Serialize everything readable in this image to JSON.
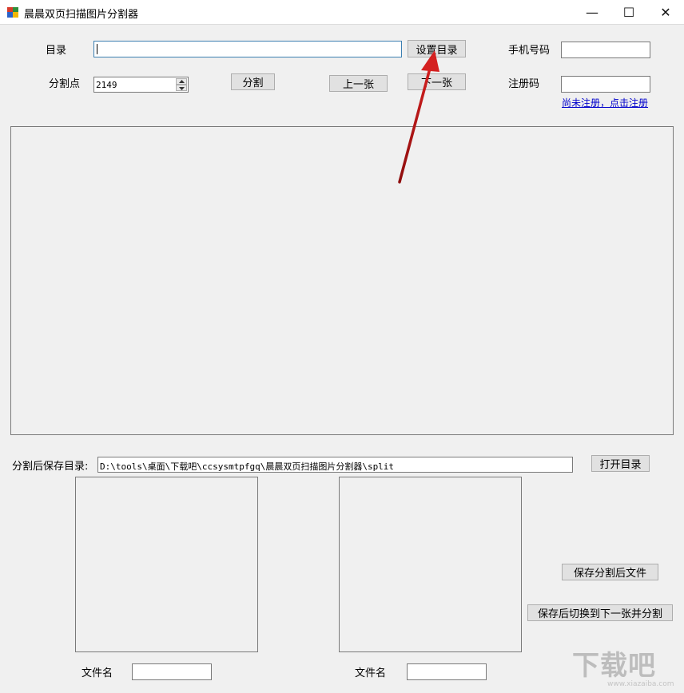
{
  "window": {
    "title": "晨晨双页扫描图片分割器",
    "minimize_glyph": "—",
    "maximize_glyph": "☐",
    "close_glyph": "✕"
  },
  "directory": {
    "label": "目录",
    "value": "",
    "set_button": "设置目录"
  },
  "split_point": {
    "label": "分割点",
    "value": "2149"
  },
  "actions": {
    "split_button": "分割",
    "prev_button": "上一张",
    "next_button": "下一张"
  },
  "registration": {
    "phone_label": "手机号码",
    "phone_value": "",
    "code_label": "注册码",
    "code_value": "",
    "link_text": "尚未注册，点击注册"
  },
  "output": {
    "label": "分割后保存目录:",
    "path": "D:\\tools\\桌面\\下载吧\\ccsysmtpfgq\\晨晨双页扫描图片分割器\\split",
    "open_button": "打开目录"
  },
  "bottom": {
    "save_button": "保存分割后文件",
    "save_next_button": "保存后切换到下一张并分割",
    "filename_label_left": "文件名",
    "filename_value_left": "",
    "filename_label_right": "文件名",
    "filename_value_right": ""
  },
  "colors": {
    "annotation_arrow": "#d42020",
    "link": "#0000cc"
  },
  "watermark": {
    "text": "下载吧",
    "url": "www.xiazaiba.com"
  }
}
